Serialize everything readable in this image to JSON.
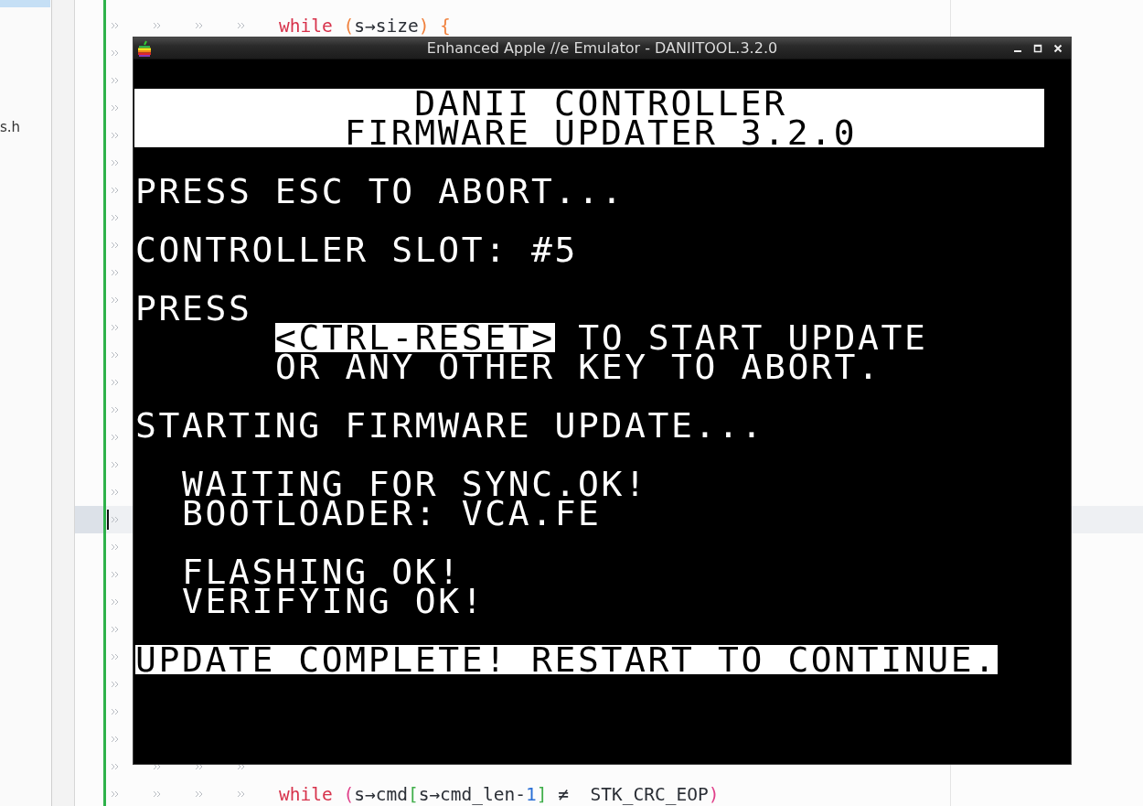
{
  "editor": {
    "sidebar_items": [
      {
        "label": "s.h"
      }
    ],
    "lines_top": [
      {
        "tokens": [
          {
            "kind": "keyword",
            "text": "while"
          },
          {
            "kind": "bracket_a",
            "text": " ("
          },
          {
            "kind": "plain",
            "text": "s→size"
          },
          {
            "kind": "bracket_a",
            "text": ") {"
          }
        ]
      }
    ],
    "hidden_rows": [
      {
        "current": false
      },
      {
        "current": false
      },
      {
        "current": false
      },
      {
        "current": false
      },
      {
        "current": false
      },
      {
        "current": false
      },
      {
        "current": false
      },
      {
        "current": false
      },
      {
        "current": false
      },
      {
        "current": false
      },
      {
        "current": false
      },
      {
        "current": false
      },
      {
        "current": false
      },
      {
        "current": false
      },
      {
        "current": false
      },
      {
        "current": false
      },
      {
        "current": false
      },
      {
        "current": true
      },
      {
        "current": false
      },
      {
        "current": false
      },
      {
        "current": false
      },
      {
        "current": false
      },
      {
        "current": false
      },
      {
        "current": false
      },
      {
        "current": false
      },
      {
        "current": false
      }
    ],
    "lines_bottom": [
      {
        "tokens": [
          {
            "kind": "keyword",
            "text": "while"
          },
          {
            "kind": "bracket_b",
            "text": " ("
          },
          {
            "kind": "plain",
            "text": "s→cmd"
          },
          {
            "kind": "bracket_c",
            "text": "["
          },
          {
            "kind": "plain",
            "text": "s→cmd_len-"
          },
          {
            "kind": "number",
            "text": "1"
          },
          {
            "kind": "bracket_c",
            "text": "]"
          },
          {
            "kind": "plain",
            "text": " ≠  STK_CRC_EOP"
          },
          {
            "kind": "bracket_b",
            "text": ")"
          }
        ]
      }
    ]
  },
  "emulator": {
    "title": "Enhanced Apple //e Emulator - DANIITOOL.3.2.0",
    "screen": {
      "paragraphs": [
        {
          "kind": "banner",
          "lines": [
            {
              "text": "DANII CONTROLLER"
            },
            {
              "text": "FIRMWARE UPDATER 3.2.0"
            }
          ]
        },
        {
          "kind": "text",
          "lines": [
            {
              "kind": "text",
              "segments": [
                {
                  "text": "PRESS ESC TO ABORT...",
                  "inverse": false
                }
              ]
            }
          ]
        },
        {
          "kind": "text",
          "lines": [
            {
              "kind": "text",
              "segments": [
                {
                  "text": "CONTROLLER SLOT: #5",
                  "inverse": false
                }
              ]
            }
          ]
        },
        {
          "kind": "text",
          "lines": [
            {
              "kind": "text",
              "segments": [
                {
                  "text": "PRESS",
                  "inverse": false
                }
              ]
            },
            {
              "kind": "continuation",
              "segments": [
                {
                  "text": "<CTRL-RESET>",
                  "inverse": true
                },
                {
                  "text": "TO START UPDATE",
                  "inverse": false
                }
              ]
            },
            {
              "kind": "continuation",
              "segments": [
                {
                  "text": "OR ANY OTHER KEY TO ABORT.",
                  "inverse": false
                }
              ]
            }
          ]
        },
        {
          "kind": "text",
          "lines": [
            {
              "kind": "text",
              "segments": [
                {
                  "text": "STARTING FIRMWARE UPDATE...",
                  "inverse": false
                }
              ]
            }
          ]
        },
        {
          "kind": "text",
          "lines": [
            {
              "kind": "step",
              "segments": [
                {
                  "text": "WAITING FOR SYNC.OK!",
                  "inverse": false
                }
              ]
            },
            {
              "kind": "step",
              "segments": [
                {
                  "text": "BOOTLOADER: VCA.FE",
                  "inverse": false
                }
              ]
            }
          ]
        },
        {
          "kind": "text",
          "lines": [
            {
              "kind": "step",
              "segments": [
                {
                  "text": "FLASHING OK!",
                  "inverse": false
                }
              ]
            },
            {
              "kind": "step",
              "segments": [
                {
                  "text": "VERIFYING OK!",
                  "inverse": false
                }
              ]
            }
          ]
        },
        {
          "kind": "text",
          "lines": [
            {
              "kind": "text",
              "segments": [
                {
                  "text": "UPDATE COMPLETE! RESTART TO CONTINUE.",
                  "inverse": true
                }
              ]
            }
          ]
        }
      ]
    }
  }
}
